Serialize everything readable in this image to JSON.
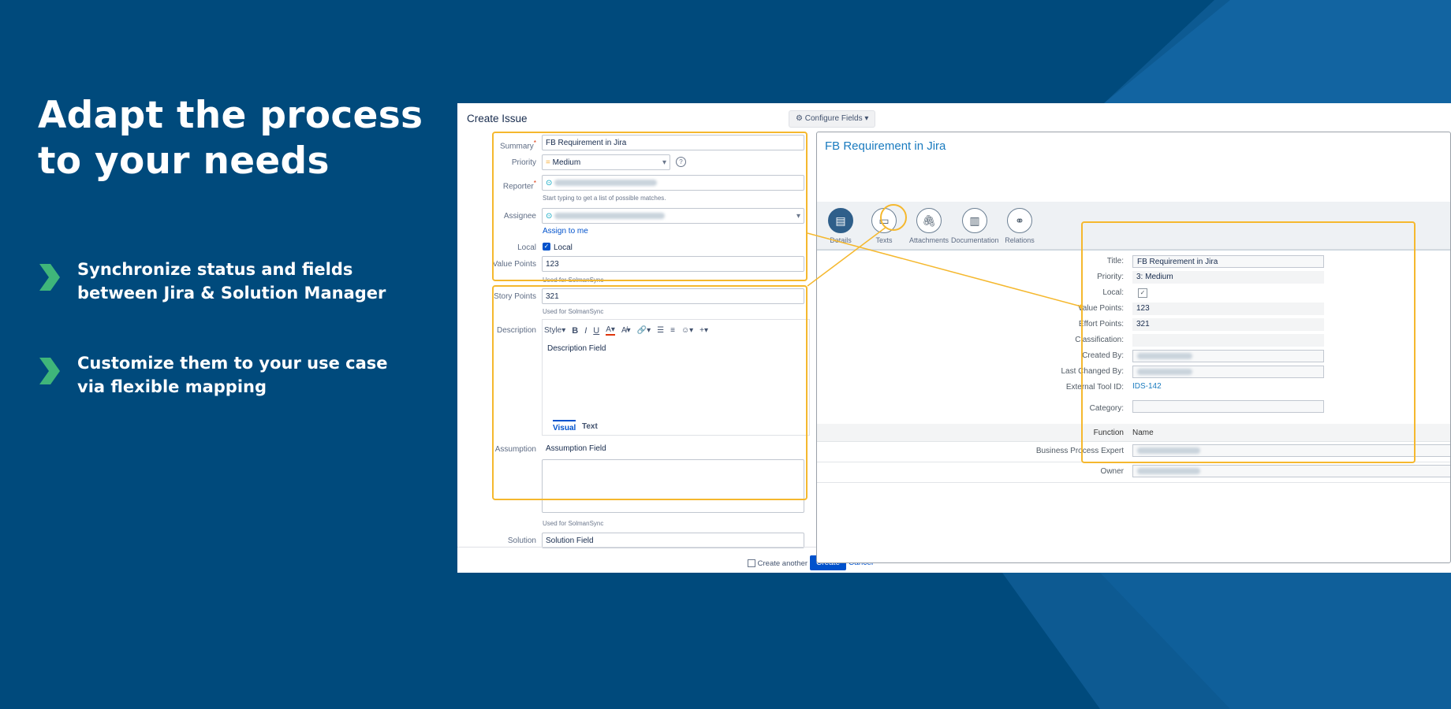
{
  "hero": {
    "line1": "Adapt the process",
    "line2": "to your needs"
  },
  "bullets": [
    {
      "line1": "Synchronize status and fields",
      "line2": "between Jira & Solution Manager"
    },
    {
      "line1": "Customize them to your use case",
      "line2": "via flexible mapping"
    }
  ],
  "colors": {
    "background": "#004a7c",
    "accent_green": "#3fb57a",
    "highlight": "#f5b82e",
    "link": "#0052cc"
  },
  "create_issue": {
    "title": "Create Issue",
    "configure_fields": "Configure Fields",
    "fields": {
      "summary_label": "Summary",
      "summary_value": "FB Requirement in Jira",
      "priority_label": "Priority",
      "priority_value": "Medium",
      "reporter_label": "Reporter",
      "reporter_hint": "Start typing to get a list of possible matches.",
      "assignee_label": "Assignee",
      "assign_to_me": "Assign to me",
      "local_label": "Local",
      "local_checkbox_label": "Local",
      "value_points_label": "Value Points",
      "value_points_value": "123",
      "value_points_hint": "Used for SolmanSync",
      "story_points_label": "Story Points",
      "story_points_value": "321",
      "story_points_hint": "Used for SolmanSync",
      "description_label": "Description",
      "description_value": "Description Field",
      "editor_style": "Style",
      "tab_visual": "Visual",
      "tab_text": "Text",
      "assumption_label": "Assumption",
      "assumption_value": "Assumption Field",
      "assumption_hint": "Used for SolmanSync",
      "solution_label": "Solution",
      "solution_value": "Solution Field"
    },
    "footer": {
      "create_another": "Create another",
      "create_button": "Create",
      "cancel": "Cancel"
    }
  },
  "solman": {
    "title": "FB Requirement in Jira",
    "nav": [
      "Details",
      "Texts",
      "Attachments",
      "Documentation",
      "Relations"
    ],
    "fields": {
      "title_label": "Title:",
      "title_value": "FB Requirement in Jira",
      "priority_label": "Priority:",
      "priority_value": "3: Medium",
      "local_label": "Local:",
      "value_points_label": "Value Points:",
      "value_points_value": "123",
      "effort_points_label": "Effort Points:",
      "effort_points_value": "321",
      "classification_label": "Classification:",
      "created_by_label": "Created By:",
      "last_changed_by_label": "Last Changed By:",
      "external_tool_id_label": "External Tool ID:",
      "external_tool_id_value": "IDS-142",
      "category_label": "Category:",
      "function_label": "Function",
      "function_header_name": "Name",
      "business_process_expert_label": "Business Process Expert",
      "owner_label": "Owner"
    }
  }
}
